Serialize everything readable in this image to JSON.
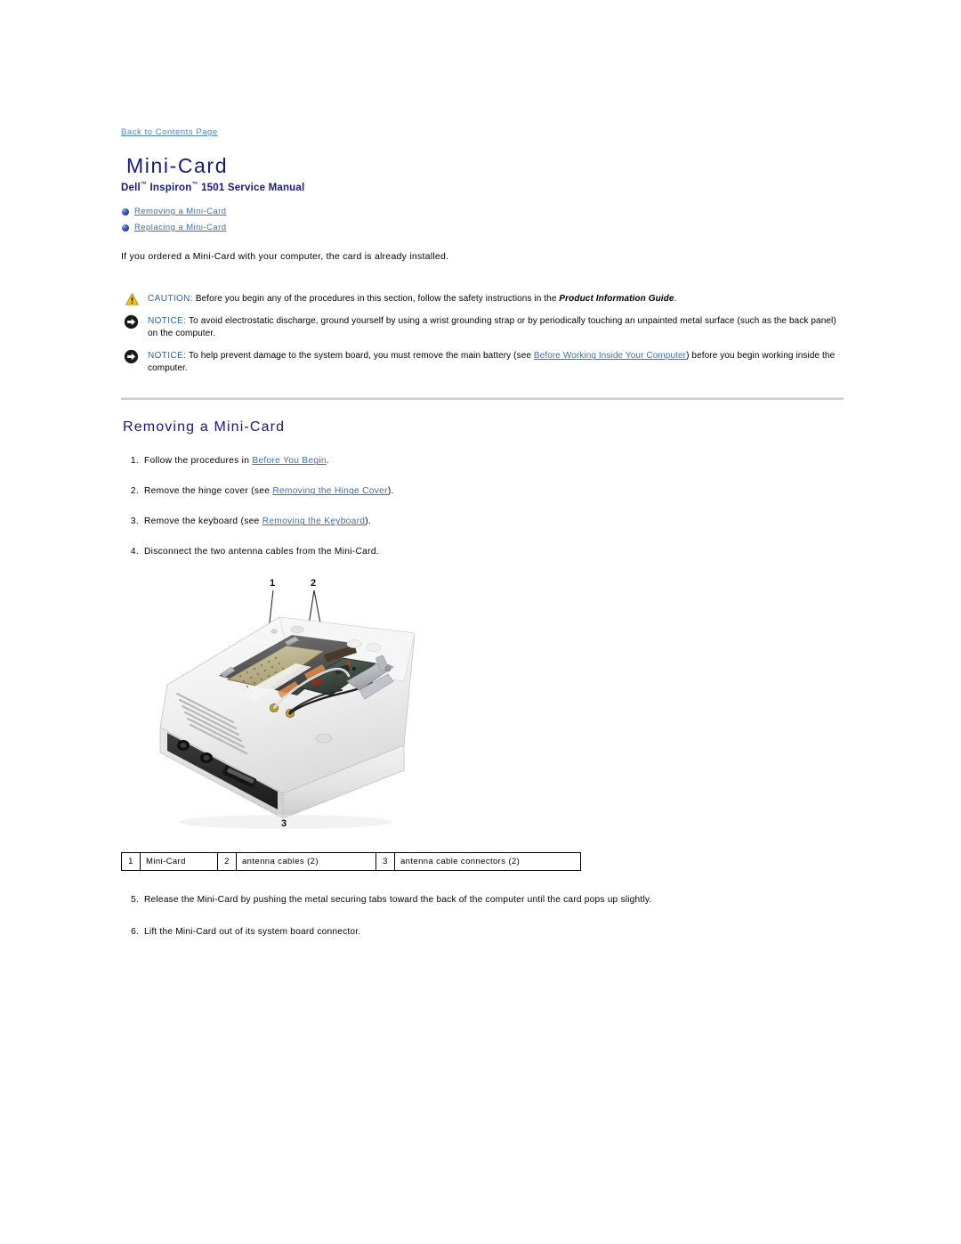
{
  "nav": {
    "back_link": "Back to Contents Page"
  },
  "header": {
    "title": "Mini-Card",
    "subtitle_part1": "Dell",
    "subtitle_tm1": "™",
    "subtitle_part2": " Inspiron",
    "subtitle_tm2": "™",
    "subtitle_part3": " 1501 Service Manual",
    "subtitle_full": "Dell™ Inspiron™ 1501 Service Manual"
  },
  "toc": {
    "items": [
      {
        "label": "Removing a Mini-Card"
      },
      {
        "label": "Replacing a Mini-Card"
      }
    ]
  },
  "intro": {
    "text": "If you ordered a Mini-Card with your computer, the card is already installed."
  },
  "admonitions": [
    {
      "icon": "caution-triangle-icon",
      "label": "CAUTION:",
      "text_before": " Before you begin any of the procedures in this section, follow the safety instructions in the ",
      "emphasis": "Product Information Guide",
      "text_after": "."
    },
    {
      "icon": "notice-arrow-icon",
      "label": "NOTICE:",
      "text_before": " To avoid electrostatic discharge, ground yourself by using a wrist grounding strap or by periodically touching an unpainted metal surface (such as the back panel) on the computer.",
      "emphasis": "",
      "text_after": ""
    },
    {
      "icon": "notice-arrow-icon",
      "label": "NOTICE:",
      "text_before": " To help prevent damage to the system board, you must remove the main battery (see ",
      "link": "Before Working Inside Your Computer",
      "text_after": ") before you begin working inside the computer.",
      "emphasis": ""
    }
  ],
  "section": {
    "heading": "Removing a Mini-Card"
  },
  "steps": [
    {
      "num": "1.",
      "text_before": "Follow the procedures in ",
      "link": "Before You Begin",
      "text_after": "."
    },
    {
      "num": "2.",
      "text_before": "Remove the hinge cover (see ",
      "link": "Removing the Hinge Cover",
      "text_after": ")."
    },
    {
      "num": "3.",
      "text_before": "Remove the keyboard (see ",
      "link": "Removing the Keyboard",
      "text_after": ")."
    },
    {
      "num": "4.",
      "text_before": "Disconnect the two antenna cables from the Mini-Card.",
      "link": "",
      "text_after": ""
    }
  ],
  "figure": {
    "alt": "Underside of Dell Inspiron 1501 laptop showing Mini-Card bay with antenna cables connected",
    "callouts": [
      {
        "id": "1"
      },
      {
        "id": "2"
      },
      {
        "id": "3"
      }
    ]
  },
  "legend": {
    "rows": [
      {
        "idx": "1",
        "label": "Mini-Card"
      },
      {
        "idx": "2",
        "label": "antenna cables (2)"
      },
      {
        "idx": "3",
        "label": "antenna cable connectors (2)"
      }
    ]
  },
  "steps_tail": [
    {
      "num": "5.",
      "text": "Release the Mini-Card by pushing the metal securing tabs toward the back of the computer until the card pops up slightly."
    },
    {
      "num": "6.",
      "text": "Lift the Mini-Card out of its system board connector."
    }
  ],
  "colors": {
    "heading_navy": "#17178c",
    "link_blue": "#3a6fc4",
    "back_link_blue": "#4a86d6",
    "caution_yellow": "#f5c518",
    "notice_black": "#1a1a1a",
    "rule_gray": "#c9cdd3"
  }
}
